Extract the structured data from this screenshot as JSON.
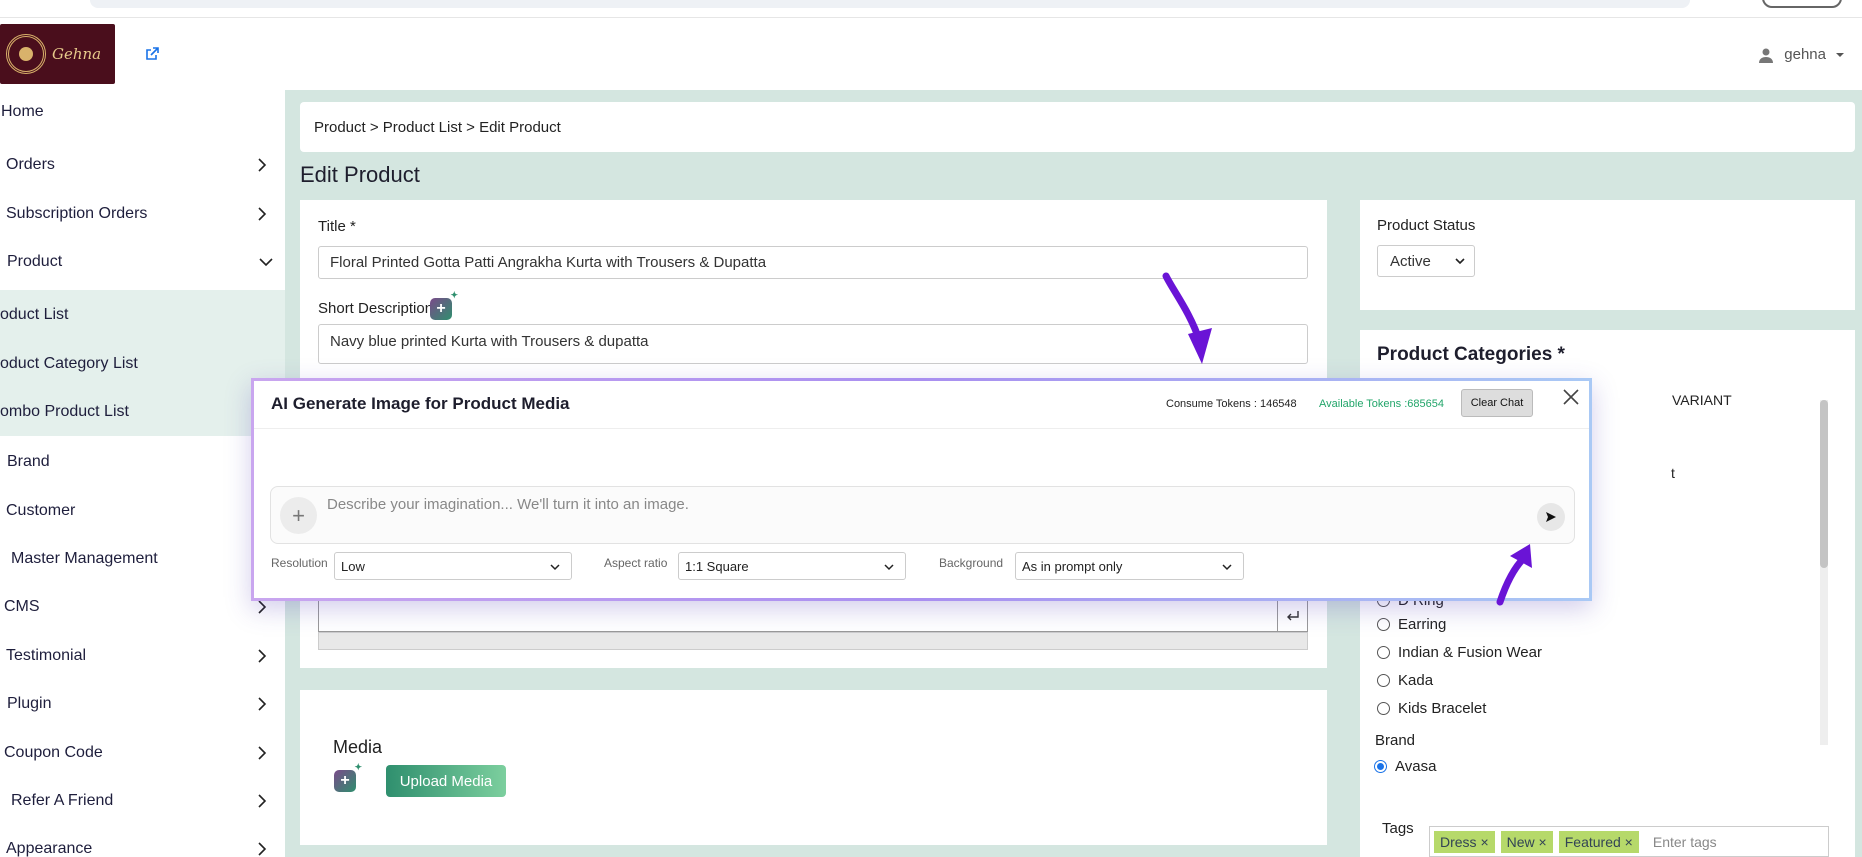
{
  "header": {
    "logo_text": "Gehna",
    "user_name": "gehna"
  },
  "sidebar": {
    "items": [
      {
        "label": "Home",
        "has_chevron": false
      },
      {
        "label": "Orders",
        "has_chevron": true
      },
      {
        "label": "Subscription Orders",
        "has_chevron": true
      },
      {
        "label": "Product",
        "has_chevron": true
      },
      {
        "label": "oduct List",
        "has_chevron": false
      },
      {
        "label": "oduct Category List",
        "has_chevron": false
      },
      {
        "label": "ombo Product List",
        "has_chevron": false
      },
      {
        "label": "Brand",
        "has_chevron": false
      },
      {
        "label": "Customer",
        "has_chevron": false
      },
      {
        "label": "Master Management",
        "has_chevron": false
      },
      {
        "label": "CMS",
        "has_chevron": true
      },
      {
        "label": "Testimonial",
        "has_chevron": true
      },
      {
        "label": "Plugin",
        "has_chevron": true
      },
      {
        "label": "Coupon Code",
        "has_chevron": true
      },
      {
        "label": "Refer A Friend",
        "has_chevron": true
      },
      {
        "label": "Appearance",
        "has_chevron": true
      }
    ]
  },
  "main": {
    "breadcrumb": "Product > Product List > Edit Product",
    "page_title": "Edit Product",
    "title_label": "Title *",
    "title_value": "Floral Printed Gotta Patti Angrakha Kurta with Trousers & Dupatta",
    "short_desc_label": "Short Description",
    "short_desc_value": "Navy blue printed Kurta with Trousers & dupatta",
    "media_label": "Media",
    "upload_button": "Upload Media"
  },
  "status": {
    "label": "Product Status",
    "value": "Active"
  },
  "categories": {
    "title": "Product Categories *",
    "partial_variant": "VARIANT",
    "partial_t": "t",
    "items": [
      "D Ring",
      "Earring",
      "Indian & Fusion Wear",
      "Kada",
      "Kids Bracelet"
    ]
  },
  "brand": {
    "label": "Brand",
    "value": "Avasa"
  },
  "tags": {
    "label": "Tags",
    "items": [
      "Dress",
      "New",
      "Featured"
    ],
    "placeholder": "Enter tags"
  },
  "modal": {
    "title": "AI Generate Image for Product Media",
    "consume_tokens": "Consume Tokens : 146548",
    "available_tokens": "Available Tokens :685654",
    "clear_chat": "Clear Chat",
    "prompt_placeholder": "Describe your imagination... We'll turn it into an image.",
    "resolution_label": "Resolution",
    "resolution_value": "Low",
    "aspect_label": "Aspect ratio",
    "aspect_value": "1:1 Square",
    "background_label": "Background",
    "background_value": "As in prompt only"
  },
  "colors": {
    "main_bg": "#d4e6e0",
    "accent_green": "#2f8f6e",
    "annotation_arrow": "#6a14d6",
    "token_green": "#22a56a"
  }
}
